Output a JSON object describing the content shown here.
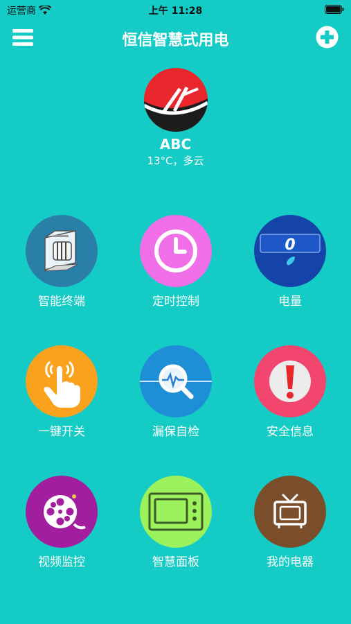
{
  "status_bar": {
    "carrier": "运营商",
    "time": "上午 11:28"
  },
  "header": {
    "title": "恒信智慧式用电"
  },
  "profile": {
    "name": "ABC",
    "weather": "13°C，多云"
  },
  "colors": {
    "background": "#14CBC6",
    "terminal": "#2A7FA8",
    "timer": "#F06FE8",
    "power": "#1444A8",
    "switch": "#FAA21E",
    "leak_test": "#1E8FD6",
    "safety": "#F2466E",
    "video": "#A31E9E",
    "panel": "#9CF25C",
    "appliances": "#7A4E2A",
    "logo_red": "#E8262B",
    "logo_black": "#1C1C1C"
  },
  "features": [
    {
      "id": "terminal",
      "label": "智能终端",
      "icon": "smart-terminal-icon"
    },
    {
      "id": "timer",
      "label": "定时控制",
      "icon": "clock-icon"
    },
    {
      "id": "power",
      "label": "电量",
      "icon": "power-meter-icon",
      "value": "0"
    },
    {
      "id": "switch",
      "label": "一键开关",
      "icon": "touch-hand-icon"
    },
    {
      "id": "leak_test",
      "label": "漏保自检",
      "icon": "magnifier-icon"
    },
    {
      "id": "safety",
      "label": "安全信息",
      "icon": "exclamation-icon"
    },
    {
      "id": "video",
      "label": "视频监控",
      "icon": "film-reel-icon"
    },
    {
      "id": "panel",
      "label": "智慧面板",
      "icon": "panel-icon"
    },
    {
      "id": "appliances",
      "label": "我的电器",
      "icon": "tv-icon"
    }
  ]
}
